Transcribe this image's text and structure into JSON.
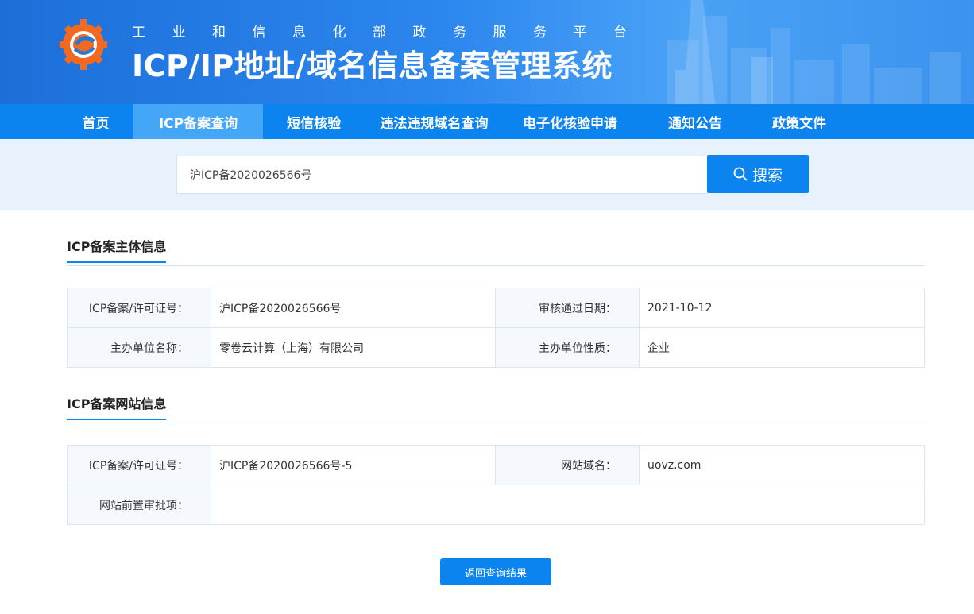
{
  "header": {
    "subtitle": "工业和信息化部政务服务平台",
    "title": "ICP/IP地址/域名信息备案管理系统"
  },
  "nav": {
    "items": [
      {
        "label": "首页",
        "active": false
      },
      {
        "label": "ICP备案查询",
        "active": true
      },
      {
        "label": "短信核验",
        "active": false
      },
      {
        "label": "违法违规域名查询",
        "active": false
      },
      {
        "label": "电子化核验申请",
        "active": false
      },
      {
        "label": "通知公告",
        "active": false
      },
      {
        "label": "政策文件",
        "active": false
      }
    ]
  },
  "search": {
    "value": "沪ICP备2020026566号",
    "button_label": "搜索",
    "button_icon": "search-icon"
  },
  "subject_info": {
    "title": "ICP备案主体信息",
    "rows": [
      {
        "label1": "ICP备案/许可证号：",
        "value1": "沪ICP备2020026566号",
        "label2": "审核通过日期：",
        "value2": "2021-10-12"
      },
      {
        "label1": "主办单位名称：",
        "value1": "零卷云计算（上海）有限公司",
        "label2": "主办单位性质：",
        "value2": "企业"
      }
    ]
  },
  "site_info": {
    "title": "ICP备案网站信息",
    "row1": {
      "label1": "ICP备案/许可证号：",
      "value1": "沪ICP备2020026566号-5",
      "label2": "网站域名：",
      "value2": "uovz.com"
    },
    "row2": {
      "label1": "网站前置审批项：",
      "value1": ""
    }
  },
  "back_button_label": "返回查询结果",
  "colors": {
    "primary": "#0c84f0",
    "nav_active": "#44a6f7",
    "search_band": "#e8f2fc",
    "logo_orange": "#f26a21"
  }
}
